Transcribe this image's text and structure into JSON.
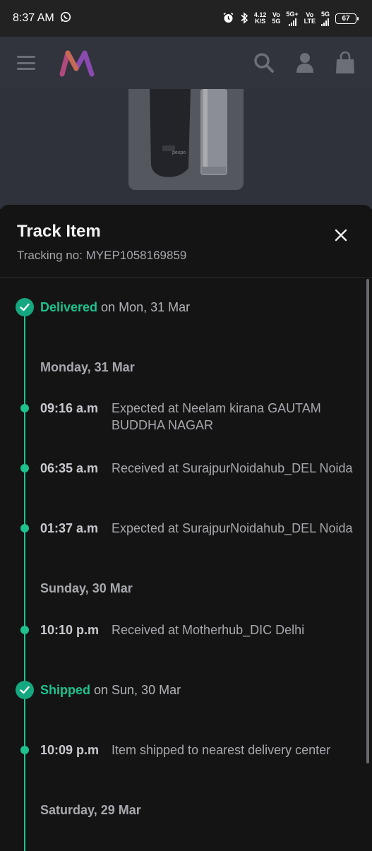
{
  "status_bar": {
    "time": "8:37 AM",
    "net_speed": "4.12",
    "net_unit": "K/S",
    "sim1_top": "Vo",
    "sim1_bottom": "5G",
    "sim1_gen": "5G+",
    "sim2_top": "Vo",
    "sim2_bottom": "LTE",
    "sim2_gen": "5G",
    "battery": "67",
    "icons": [
      "whatsapp-icon",
      "alarm-icon",
      "bluetooth-icon",
      "signal-icon",
      "battery-icon"
    ]
  },
  "header": {
    "icons": [
      "menu-icon",
      "brand-logo",
      "search-icon",
      "profile-icon",
      "bag-icon"
    ],
    "logo_colors": [
      "#ff3f6c",
      "#f28c38",
      "#a34bc9"
    ]
  },
  "product_thumb": {
    "brand_text": "pexpo"
  },
  "sheet": {
    "title": "Track Item",
    "tracking_no": "Tracking no: MYEP1058169859",
    "accent": "#1ec28f"
  },
  "timeline": {
    "delivered": {
      "status": "Delivered",
      "suffix": " on Mon, 31 Mar"
    },
    "date_mon": "Monday, 31 Mar",
    "ev1": {
      "time": "09:16 a.m",
      "desc": "Expected at Neelam kirana GAUTAM BUDDHA NAGAR"
    },
    "ev2": {
      "time": "06:35 a.m",
      "desc": "Received at SurajpurNoidahub_DEL Noida"
    },
    "ev3": {
      "time": "01:37 a.m",
      "desc": "Expected at SurajpurNoidahub_DEL Noida"
    },
    "date_sun": "Sunday, 30 Mar",
    "ev4": {
      "time": "10:10 p.m",
      "desc": "Received at Motherhub_DIC Delhi"
    },
    "shipped": {
      "status": "Shipped",
      "suffix": " on Sun, 30 Mar"
    },
    "ev5": {
      "time": "10:09 p.m",
      "desc": "Item shipped to nearest delivery center"
    },
    "date_sat": "Saturday, 29 Mar"
  }
}
